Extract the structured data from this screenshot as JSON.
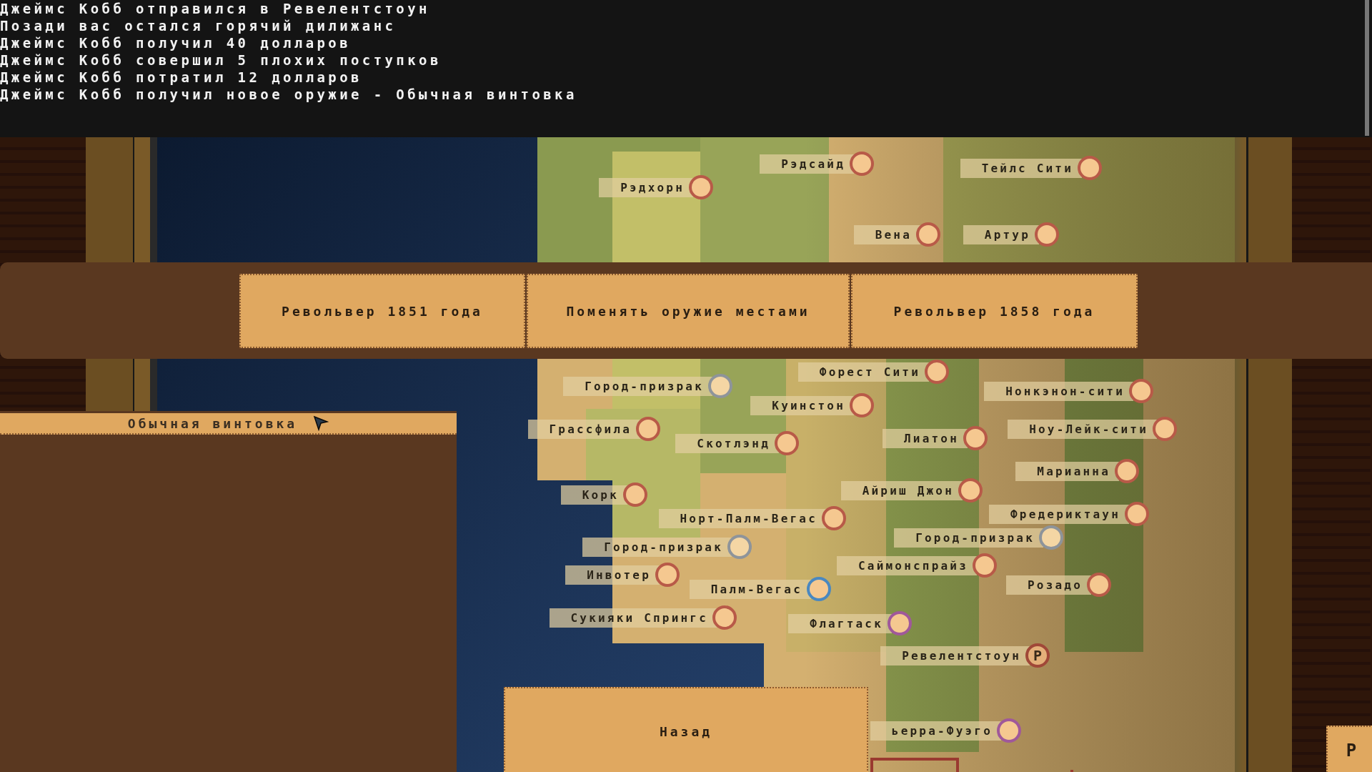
{
  "log": {
    "lines": [
      "Джеймс Кобб отправился в Ревелентстоун",
      "Позади вас остался горячий дилижанс",
      "Джеймс Кобб получил 40 долларов",
      "Джеймс Кобб совершил 5 плохих поступков",
      "Джеймс Кобб потратил 12 долларов",
      "Джеймс Кобб получил новое оружие - Обычная винтовка"
    ]
  },
  "map": {
    "cities": [
      {
        "name": "Рэдсайд",
        "kind": "town"
      },
      {
        "name": "Тейлс Сити",
        "kind": "town"
      },
      {
        "name": "Рэдхорн",
        "kind": "town"
      },
      {
        "name": "Вена",
        "kind": "town"
      },
      {
        "name": "Артур",
        "kind": "town"
      },
      {
        "name": "Форест Сити",
        "kind": "town"
      },
      {
        "name": "Город-призрак",
        "kind": "ghost"
      },
      {
        "name": "Нонкэнон-сити",
        "kind": "town"
      },
      {
        "name": "Куинстон",
        "kind": "town"
      },
      {
        "name": "Грассфила",
        "kind": "town"
      },
      {
        "name": "Скотлэнд",
        "kind": "town"
      },
      {
        "name": "Лиатон",
        "kind": "town"
      },
      {
        "name": "Ноу-Лейк-сити",
        "kind": "town"
      },
      {
        "name": "Марианна",
        "kind": "town"
      },
      {
        "name": "Айриш Джон",
        "kind": "town"
      },
      {
        "name": "Корк",
        "kind": "town"
      },
      {
        "name": "Норт-Палм-Вегас",
        "kind": "town"
      },
      {
        "name": "Фредериктаун",
        "kind": "town"
      },
      {
        "name": "Город-призрак",
        "kind": "ghost"
      },
      {
        "name": "Город-призрак",
        "kind": "ghost"
      },
      {
        "name": "Саймонспрайз",
        "kind": "town"
      },
      {
        "name": "Инвотер",
        "kind": "town"
      },
      {
        "name": "Палм-Вегас",
        "kind": "current"
      },
      {
        "name": "Розадо",
        "kind": "town"
      },
      {
        "name": "Сукияки Спрингс",
        "kind": "town"
      },
      {
        "name": "Флагтаск",
        "kind": "special"
      },
      {
        "name": "Ревелентстоун",
        "kind": "station",
        "marker_text": "P"
      },
      {
        "name": "ьерра-Фуэго",
        "kind": "special"
      }
    ]
  },
  "weapon_bar": {
    "buttons": [
      "Револьвер 1851 года",
      "Поменять оружие местами",
      "Револьвер 1858 года"
    ]
  },
  "inventory_panel": {
    "header": "Обычная винтовка"
  },
  "back_button": "Назад",
  "corner_button": "P"
}
